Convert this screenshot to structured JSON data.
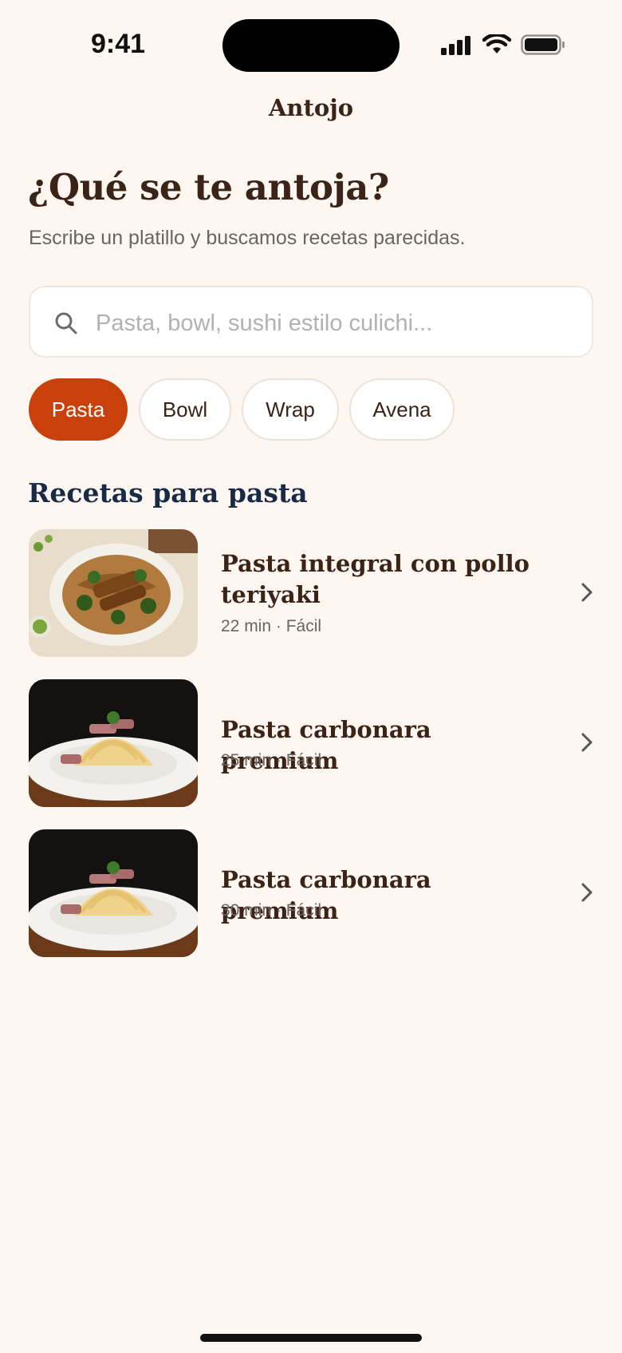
{
  "status": {
    "time": "9:41"
  },
  "app": {
    "title": "Antojo"
  },
  "hero": {
    "headline": "¿Qué se te antoja?",
    "subtitle": "Escribe un platillo y buscamos recetas parecidas."
  },
  "search": {
    "placeholder": "Pasta, bowl, sushi estilo culichi...",
    "value": "",
    "icon": "search-icon"
  },
  "chips": [
    {
      "label": "Pasta",
      "selected": true
    },
    {
      "label": "Bowl",
      "selected": false
    },
    {
      "label": "Wrap",
      "selected": false
    },
    {
      "label": "Avena",
      "selected": false
    }
  ],
  "section": {
    "title": "Recetas para pasta"
  },
  "recipes": [
    {
      "title": "Pasta integral con pollo teriyaki",
      "meta": "22 min · Fácil",
      "image": "teriyaki-pasta-photo"
    },
    {
      "title": "Pasta carbonara premium",
      "meta": "25 min · Fácil",
      "image": "carbonara-photo"
    },
    {
      "title": "Pasta carbonara premium",
      "meta": "30 min · Fácil",
      "image": "carbonara-photo"
    }
  ],
  "colors": {
    "background": "#fdf6f1",
    "accent": "#c9400a",
    "heading": "#3a2418",
    "section_heading": "#182a45"
  }
}
